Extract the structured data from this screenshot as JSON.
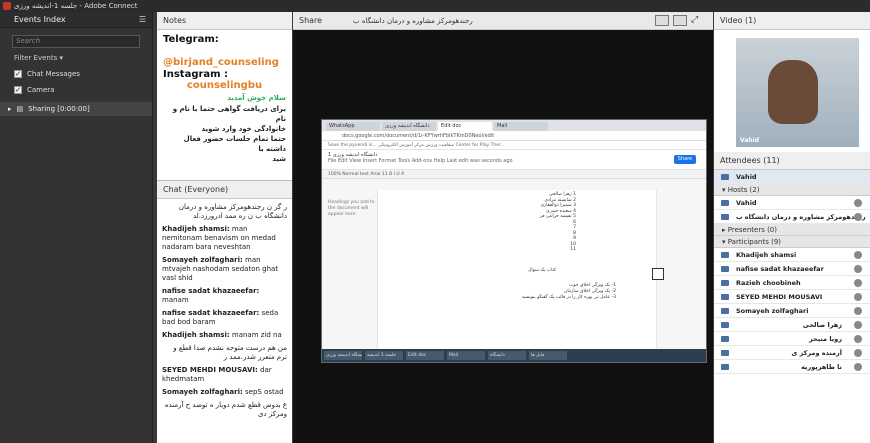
{
  "window": {
    "title": "جلسه 1-اندیشه ورزی - Adobe Connect"
  },
  "events": {
    "title": "Events Index",
    "search_placeholder": "Search",
    "filter_label": "Filter Events",
    "filters": [
      {
        "label": "Chat Messages",
        "checked": true
      },
      {
        "label": "Camera",
        "checked": true
      }
    ],
    "sharing_label": "Sharing [0:00:00]"
  },
  "notes": {
    "title": "Notes",
    "telegram": "Telegram:",
    "handle": "@birjand_counseling",
    "instagram": "Instagram :",
    "instagram_handle": "counselingbu",
    "greeting": "سلام خوش آمدید",
    "line1": "برای دریافت گواهی حتما با نام و نام",
    "line2": "خانوادگی خود وارد شوید",
    "line3": "حتما تمام جلسات حضور فعال داشته با",
    "line4": "شید"
  },
  "chat": {
    "title": "Chat",
    "scope": "(Everyone)",
    "messages": [
      {
        "who": "",
        "text": "ر گر ن رجندهومرکز مشاوره و درمان دانشگاه ب ن ره ممد ادرورزد.لد",
        "rtl": true
      },
      {
        "who": "Khadijeh shamsi:",
        "text": " man nemitonam benavism on medad nadaram bara neveshtan",
        "rtl": false
      },
      {
        "who": "Somayeh zolfaghari:",
        "text": " man mtvajeh nashodam sedaton ghat vasl shid",
        "rtl": false
      },
      {
        "who": "nafise sadat khazaeefar:",
        "text": " manam",
        "rtl": false
      },
      {
        "who": "nafise sadat khazaeefar:",
        "text": " seda bad bod baram",
        "rtl": false
      },
      {
        "who": "Khadijeh shamsi:",
        "text": " manam zid na",
        "rtl": false
      },
      {
        "who": "",
        "text": "من هم درست متوجه نشدم صدا قطع و ترم متعرر شدر.ممد ر",
        "rtl": true
      },
      {
        "who": "SEYED MEHDI MOUSAVI:",
        "text": " dar khedmatam",
        "rtl": false
      },
      {
        "who": "Somayeh zolfaghari:",
        "text": " sepS ostad",
        "rtl": false
      },
      {
        "who": "",
        "text": "ع بدوس قطع شدم دوبار ه توضد ح آرمنده ومرکز دی",
        "rtl": true
      }
    ]
  },
  "share": {
    "title": "Share",
    "doc_title": "رجندهومرکز مشاوره و درمان دانشگاه ب"
  },
  "browser": {
    "tabs": [
      "WhatsApp",
      "دانشگاه اندیشه ورزی",
      "Edit doc",
      "Mail"
    ],
    "url": "docs.google.com/document/d/1r-KFYwrhFbIkTKmD0Neoi/edit",
    "bookmarks": "Save the pyvendi is...   شفافیت ورزش   مرکز آموزش الکترونیکی   Center for Play Ther...",
    "doc_name": "دانشگاه اندیشه ورزی 1",
    "menu": "File  Edit  View  Insert  Format  Tools  Add-ons  Help   Last edit was seconds ago",
    "share_btn": "Share",
    "format_bar": "100%   Normal text   Arial   11   B  I  U  A",
    "outline_hint": "Headings you add to the document will appear here.",
    "doc_lines": [
      "1 زهرا صالحی",
      "2 شایسته مرادی",
      "3 سمیرا ذوالفقاری",
      "4 سعیده حیدری",
      "5 نفیسه خزاعی فر",
      "6",
      "7",
      "8",
      "9",
      "10",
      "11"
    ],
    "doc_heading": "کتاب یک سوال",
    "doc_items": [
      "1- یک ویژگی اخلاق خوب",
      "2- یک ویژگی اخلاق سازمان",
      "3- عامل تی بهره کار را در قالب یک گفتگو بنویسید"
    ],
    "taskbar": [
      "دانشگاه اندیشه ورزی",
      "جلسه 1 اندیشه",
      "Edit doc",
      "Mail",
      "دانشگاه",
      "فایل ها"
    ]
  },
  "video": {
    "title": "Video",
    "count": "(1)",
    "presenter": "Vahid"
  },
  "attendees": {
    "title": "Attendees",
    "count": "(11)",
    "me": "Vahid",
    "hosts_label": "Hosts (2)",
    "hosts": [
      "Vahid",
      "رجندهومرکز مشاوره و درمان دانشگاه ب"
    ],
    "presenters_label": "Presenters (0)",
    "participants_label": "Participants (9)",
    "participants": [
      {
        "name": "Khadijeh shamsi",
        "rtl": false
      },
      {
        "name": "nafise sadat khazaeefar",
        "rtl": false
      },
      {
        "name": "Razieh choobineh",
        "rtl": false
      },
      {
        "name": "SEYED MEHDI MOUSAVI",
        "rtl": false
      },
      {
        "name": "Somayeh zolfaghari",
        "rtl": false
      },
      {
        "name": "زهرا صالحی",
        "rtl": true
      },
      {
        "name": "رویا منیحر",
        "rtl": true
      },
      {
        "name": "آرمنده ومرکز ی",
        "rtl": true
      },
      {
        "name": "نا طاهرپوریه",
        "rtl": true
      }
    ]
  }
}
